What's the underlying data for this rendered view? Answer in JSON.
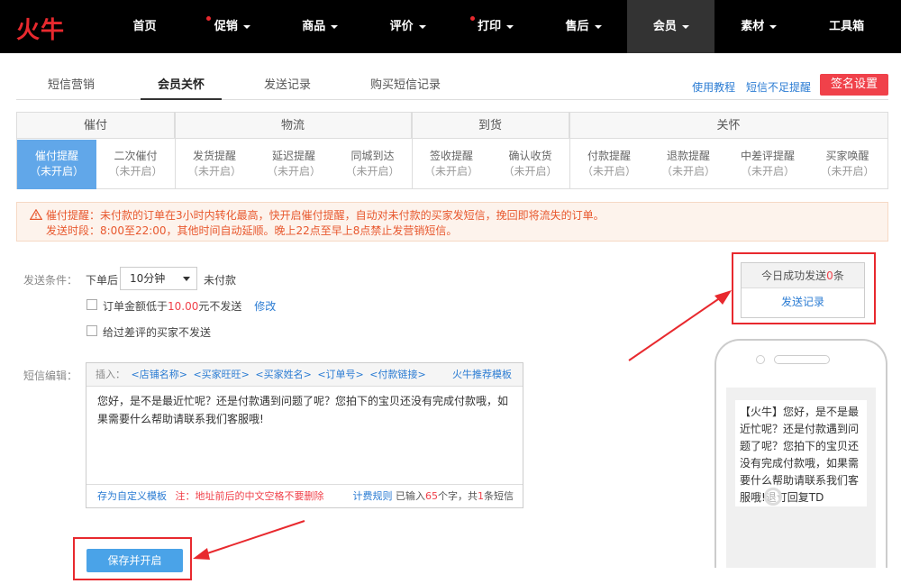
{
  "brand": {
    "logo": "火牛",
    "accent": "#e8292e"
  },
  "nav": [
    {
      "label": "首页",
      "dot": false,
      "caret": false
    },
    {
      "label": "促销",
      "dot": true,
      "caret": true
    },
    {
      "label": "商品",
      "dot": false,
      "caret": true
    },
    {
      "label": "评价",
      "dot": false,
      "caret": true
    },
    {
      "label": "打印",
      "dot": true,
      "caret": true
    },
    {
      "label": "售后",
      "dot": false,
      "caret": true
    },
    {
      "label": "会员",
      "dot": false,
      "caret": true,
      "active": true
    },
    {
      "label": "素材",
      "dot": false,
      "caret": true
    },
    {
      "label": "工具箱",
      "dot": false,
      "caret": false
    }
  ],
  "subtabs": [
    "短信营销",
    "会员关怀",
    "发送记录",
    "购买短信记录"
  ],
  "links": {
    "tutorial": "使用教程",
    "low_sms": "短信不足提醒",
    "signature": "签名设置"
  },
  "groups": [
    "催付",
    "物流",
    "到货",
    "关怀"
  ],
  "cells": [
    {
      "name": "催付提醒",
      "status": "（未开启）"
    },
    {
      "name": "二次催付",
      "status": "（未开启）"
    },
    {
      "name": "发货提醒",
      "status": "（未开启）"
    },
    {
      "name": "延迟提醒",
      "status": "（未开启）"
    },
    {
      "name": "同城到达",
      "status": "（未开启）"
    },
    {
      "name": "签收提醒",
      "status": "（未开启）"
    },
    {
      "name": "确认收货",
      "status": "（未开启）"
    },
    {
      "name": "付款提醒",
      "status": "（未开启）"
    },
    {
      "name": "退款提醒",
      "status": "（未开启）"
    },
    {
      "name": "中差评提醒",
      "status": "（未开启）"
    },
    {
      "name": "买家唤醒",
      "status": "（未开启）"
    }
  ],
  "warning": {
    "line1": "催付提醒：未付款的订单在3小时内转化最高，快开启催付提醒，自动对未付款的买家发短信，挽回即将流失的订单。",
    "line2": "发送时段：8:00至22:00，其他时间自动延顺。晚上22点至早上8点禁止发营销短信。"
  },
  "form": {
    "cond_label": "发送条件：",
    "after_order": "下单后",
    "delay": "10分钟",
    "unpaid": "未付款",
    "amount_prefix": "订单金额低于",
    "amount": "10.00",
    "amount_suffix": "元不发送",
    "modify": "修改",
    "no_bad_review": "给过差评的买家不发送",
    "sms_label": "短信编辑："
  },
  "editor": {
    "insert_label": "插入：",
    "inserts": [
      "<店铺名称>",
      "<买家旺旺>",
      "<买家姓名>",
      "<订单号>",
      "<付款链接>"
    ],
    "template": "火牛推荐模板",
    "content": "您好，是不是最近忙呢？还是付款遇到问题了呢？您拍下的宝贝还没有完成付款哦，如果需要什么帮助请联系我们客服哦!",
    "save_custom": "存为自定义模板",
    "note": "注：地址前后的中文空格不要删除",
    "billing": "计费规则",
    "typed_prefix": "已输入",
    "typed_count": "65",
    "typed_mid": "个字，共",
    "sms_count": "1",
    "typed_suffix": "条短信"
  },
  "save_button": "保存并开启",
  "stats": {
    "today_prefix": "今日成功发送",
    "today_count": "0",
    "today_suffix": "条",
    "record_link": "发送记录"
  },
  "preview": "【火牛】您好，是不是最近忙呢？还是付款遇到问题了呢？您拍下的宝贝还没有完成付款哦，如果需要什么帮助请联系我们客服哦!退订回复TD"
}
